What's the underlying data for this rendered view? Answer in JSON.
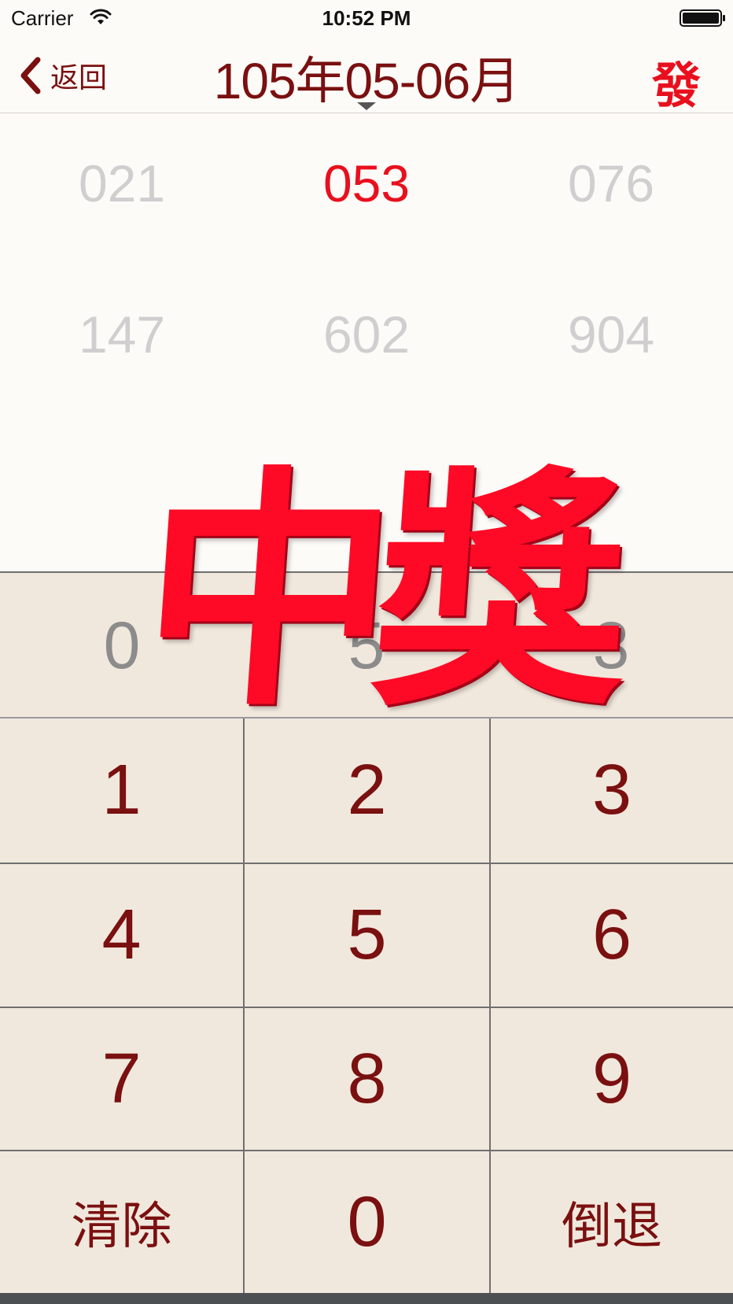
{
  "status_bar": {
    "carrier": "Carrier",
    "time": "10:52 PM"
  },
  "nav": {
    "back_label": "返回",
    "title": "105年05-06月",
    "send_label": "發"
  },
  "numbers": {
    "row1": [
      "021",
      "053",
      "076"
    ],
    "row2": [
      "147",
      "602",
      "904"
    ],
    "highlighted": "053"
  },
  "display": {
    "digits": [
      "0",
      "5",
      "3"
    ]
  },
  "keypad": {
    "keys": [
      "1",
      "2",
      "3",
      "4",
      "5",
      "6",
      "7",
      "8",
      "9",
      "清除",
      "0",
      "倒退"
    ]
  },
  "overlay": {
    "text": "中獎"
  },
  "colors": {
    "accent": "#e8101e",
    "text_dark_red": "#7a1010",
    "keypad_bg": "#f1e8dd",
    "page_bg": "#fdfbf7"
  },
  "icons": {
    "wifi": "wifi-icon",
    "battery": "battery-icon",
    "back": "chevron-left-icon",
    "caret": "caret-down-icon"
  }
}
